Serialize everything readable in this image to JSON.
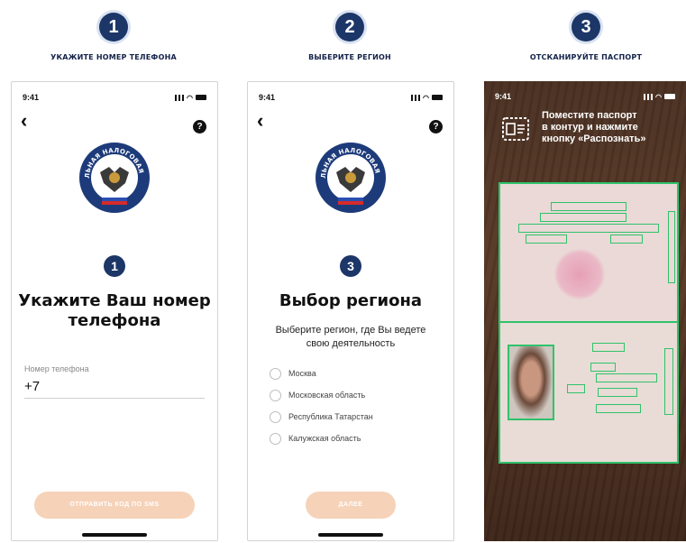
{
  "steps": [
    {
      "number": "1",
      "caption": "УКАЖИТЕ НОМЕР ТЕЛЕФОНА"
    },
    {
      "number": "2",
      "caption": "ВЫБЕРИТЕ РЕГИОН"
    },
    {
      "number": "3",
      "caption": "ОТСКАНИРУЙТЕ ПАСПОРТ"
    }
  ],
  "status_time": "9:41",
  "emblem_text": "ФЕДЕРАЛЬНАЯ НАЛОГОВАЯ СЛУЖБА",
  "phone_screen": {
    "step_number": "1",
    "title_line1": "Укажите Ваш номер",
    "title_line2": "телефона",
    "field_label": "Номер телефона",
    "field_value": "+7",
    "button_label": "ОТПРАВИТЬ КОД ПО SMS"
  },
  "region_screen": {
    "step_number": "3",
    "title": "Выбор региона",
    "subtitle_line1": "Выберите регион, где Вы ведете",
    "subtitle_line2": "свою деятельность",
    "regions": [
      "Москва",
      "Московская область",
      "Республика Татарстан",
      "Калужская область"
    ],
    "button_label": "ДАЛЕЕ"
  },
  "scan_screen": {
    "hint_line1": "Поместите паспорт",
    "hint_line2": "в контур и нажмите",
    "hint_line3": "кнопку «Распознать»"
  },
  "colors": {
    "accent": "#1c3668",
    "button": "#f6d2b8",
    "scan_frame": "#2fc36a"
  }
}
